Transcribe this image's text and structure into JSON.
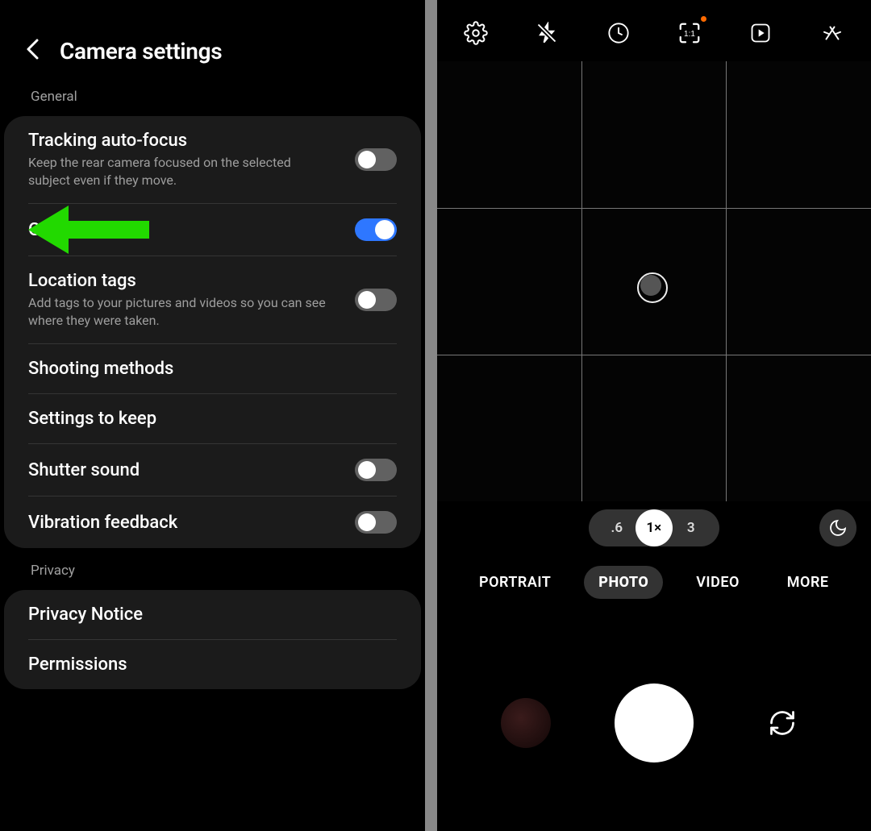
{
  "settings": {
    "title": "Camera settings",
    "sections": {
      "general_label": "General",
      "privacy_label": "Privacy"
    },
    "rows": {
      "tracking_af": {
        "title": "Tracking auto-focus",
        "sub": "Keep the rear camera focused on the selected subject even if they move.",
        "on": false
      },
      "grid_lines": {
        "title": "Grid lines",
        "on": true
      },
      "location_tags": {
        "title": "Location tags",
        "sub": "Add tags to your pictures and videos so you can see where they were taken.",
        "on": false
      },
      "shooting_methods": {
        "title": "Shooting methods"
      },
      "settings_to_keep": {
        "title": "Settings to keep"
      },
      "shutter_sound": {
        "title": "Shutter sound",
        "on": false
      },
      "vibration_feedback": {
        "title": "Vibration feedback",
        "on": false
      },
      "privacy_notice": {
        "title": "Privacy Notice"
      },
      "permissions": {
        "title": "Permissions"
      }
    }
  },
  "camera": {
    "zoom_options": {
      "wide": ".6",
      "normal": "1×",
      "tele": "3"
    },
    "modes": {
      "portrait": "PORTRAIT",
      "photo": "PHOTO",
      "video": "VIDEO",
      "more": "MORE"
    }
  }
}
